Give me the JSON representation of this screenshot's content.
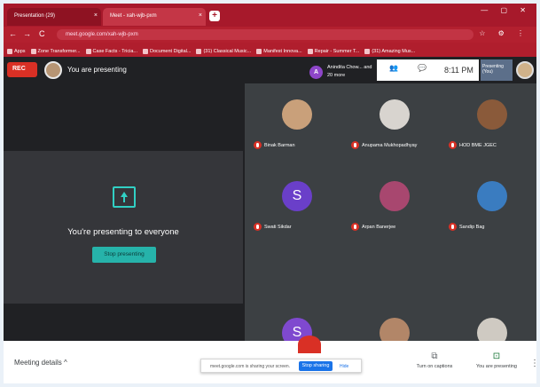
{
  "browser": {
    "tabs": [
      {
        "label": "Presentation (29)",
        "close": "×"
      },
      {
        "label": "Meet - xah-wjb-pxm",
        "close": "×"
      }
    ],
    "new_tab": "+",
    "window_controls": "— ▢ ✕",
    "nav": {
      "back": "←",
      "forward": "→",
      "reload": "C"
    },
    "url": "meet.google.com/xah-wjb-pxm",
    "address_right_icons": "☆ ⚙ ⋮",
    "bookmarks": [
      "Apps",
      "Zone Transformer...",
      "Case Facts - Tricia...",
      "Document Digital...",
      "(31) Classical Music...",
      "Manifest Innova...",
      "Repair - Summer T...",
      "(31) Amazing Mus..."
    ]
  },
  "meet": {
    "rec_label": "REC",
    "presenting_text": "You are presenting",
    "presenter_chip": {
      "initial": "A",
      "text": "Anindita Chow... and 20 more"
    },
    "top_icons": {
      "people": "👥",
      "chat": "💬"
    },
    "time": "8:11 PM",
    "shared_thumb_text": "Presenting (You)",
    "present_card": {
      "title": "You're presenting to everyone",
      "stop_button": "Stop presenting"
    },
    "participants": [
      {
        "name": "Binak Barman",
        "initial": "",
        "color": "#c9a07a"
      },
      {
        "name": "Anupama Mukhopadhyay",
        "initial": "",
        "color": "#d8d4cf"
      },
      {
        "name": "HOD BME JGEC",
        "initial": "",
        "color": "#8a5a3a"
      },
      {
        "name": "Swati Sikdar",
        "initial": "S",
        "color": "#6a3fc9"
      },
      {
        "name": "Arpan Banerjee",
        "initial": "",
        "color": "#a8476f"
      },
      {
        "name": "Sandip Bag",
        "initial": "",
        "color": "#3a7cc0"
      },
      {
        "name": "",
        "initial": "S",
        "color": "#7f49cf"
      },
      {
        "name": "",
        "initial": "",
        "color": "#b28668"
      },
      {
        "name": "",
        "initial": "",
        "color": "#cfcac2"
      }
    ]
  },
  "bottom": {
    "meeting_details": "Meeting details",
    "meeting_details_chevron": "^",
    "share_notice": "meet.google.com is sharing your screen.",
    "stop_sharing": "Stop sharing",
    "hide": "Hide",
    "captions_label": "Turn on captions",
    "captions_icon": "⧉",
    "present_label": "You are presenting",
    "present_icon": "⊡",
    "more": "⋮"
  }
}
